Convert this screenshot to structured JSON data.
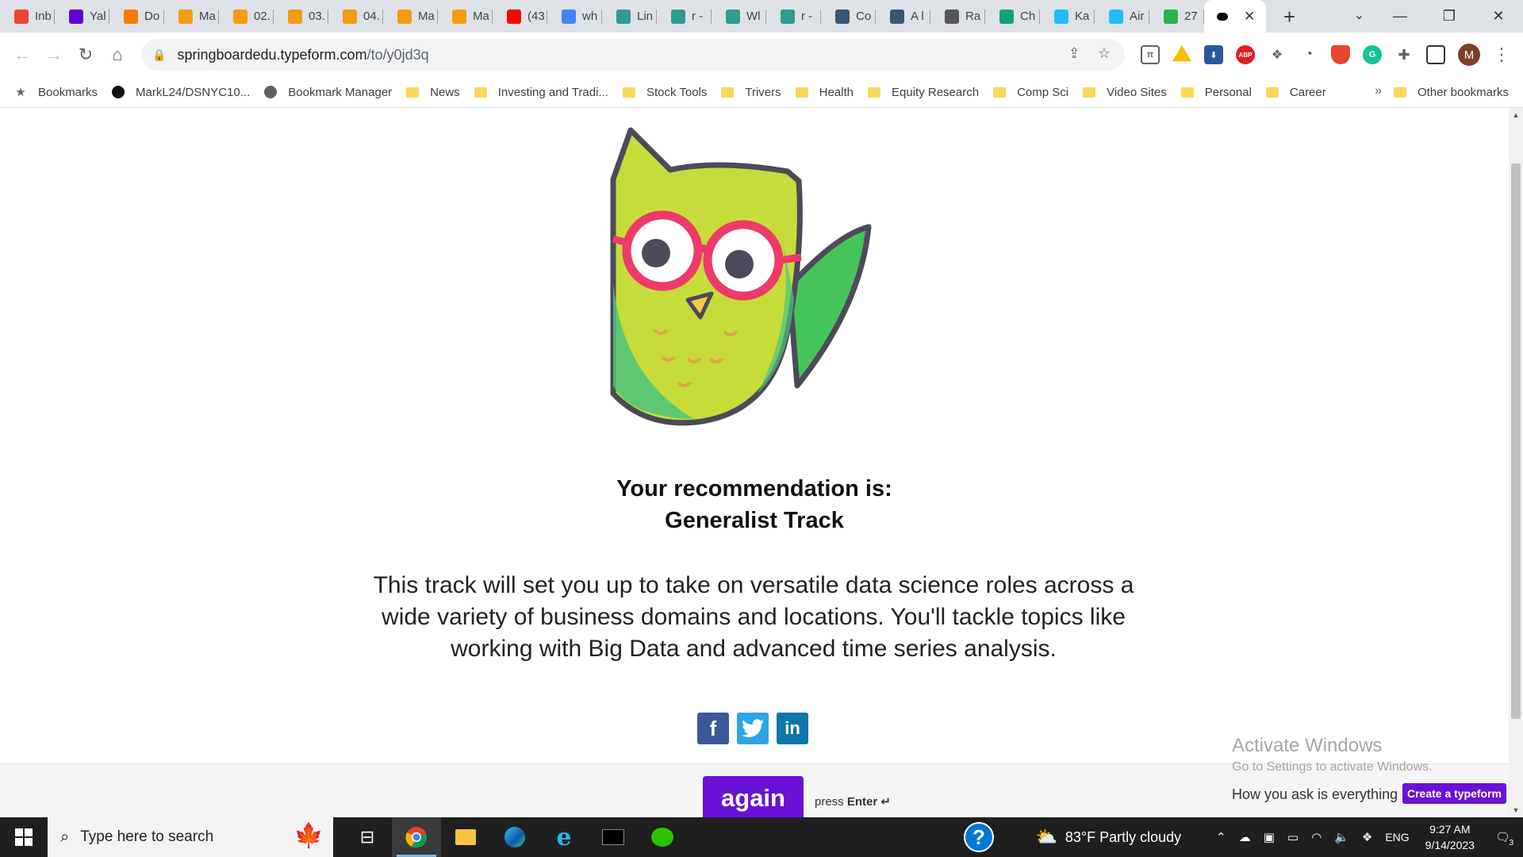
{
  "tabs": [
    {
      "label": "Inb",
      "icon": "gmail-icon",
      "color": "#ea4335"
    },
    {
      "label": "Yal",
      "icon": "yahoo-icon",
      "color": "#6001d2"
    },
    {
      "label": "Do",
      "icon": "loading-icon",
      "color": "#f57c00"
    },
    {
      "label": "Ma",
      "icon": "book-icon",
      "color": "#f39c12"
    },
    {
      "label": "02.",
      "icon": "book-icon",
      "color": "#f39c12"
    },
    {
      "label": "03.",
      "icon": "book-icon",
      "color": "#f39c12"
    },
    {
      "label": "04.",
      "icon": "hourglass-icon",
      "color": "#f39c12"
    },
    {
      "label": "Ma",
      "icon": "book-icon",
      "color": "#f39c12"
    },
    {
      "label": "Ma",
      "icon": "book-icon",
      "color": "#f39c12"
    },
    {
      "label": "(43",
      "icon": "youtube-icon",
      "color": "#ff0000"
    },
    {
      "label": "wh",
      "icon": "google-icon",
      "color": "#4285f4"
    },
    {
      "label": "Lin",
      "icon": "layers-icon",
      "color": "#2e9b8f"
    },
    {
      "label": "r -",
      "icon": "layers-icon",
      "color": "#2e9b8f"
    },
    {
      "label": "Wl",
      "icon": "layers-icon",
      "color": "#2e9b8f"
    },
    {
      "label": "r -",
      "icon": "layers-icon",
      "color": "#2e9b8f"
    },
    {
      "label": "Co",
      "icon": "tds-icon",
      "color": "#355876"
    },
    {
      "label": "A l",
      "icon": "tds-icon",
      "color": "#355876"
    },
    {
      "label": "Ra",
      "icon": "chart-icon",
      "color": "#555555"
    },
    {
      "label": "Ch",
      "icon": "openai-icon",
      "color": "#10a37f"
    },
    {
      "label": "Ka",
      "icon": "k-icon",
      "color": "#20beff"
    },
    {
      "label": "Air",
      "icon": "k-icon",
      "color": "#20beff"
    },
    {
      "label": "27",
      "icon": "dot-icon",
      "color": "#2ab24c"
    }
  ],
  "active_tab": {
    "icon": "typeform-icon"
  },
  "address": {
    "host": "springboardedu.typeform.com",
    "path": "/to/y0jd3q"
  },
  "bookmarks": [
    {
      "label": "Bookmarks",
      "icon": "star-icon"
    },
    {
      "label": "MarkL24/DSNYC10...",
      "icon": "github-icon"
    },
    {
      "label": "Bookmark Manager",
      "icon": "globe-icon"
    },
    {
      "label": "News",
      "icon": "folder-icon"
    },
    {
      "label": "Investing and Tradi...",
      "icon": "folder-icon"
    },
    {
      "label": "Stock Tools",
      "icon": "folder-icon"
    },
    {
      "label": "Trivers",
      "icon": "folder-icon"
    },
    {
      "label": "Health",
      "icon": "folder-icon"
    },
    {
      "label": "Equity Research",
      "icon": "folder-icon"
    },
    {
      "label": "Comp Sci",
      "icon": "folder-icon"
    },
    {
      "label": "Video Sites",
      "icon": "folder-icon"
    },
    {
      "label": "Personal",
      "icon": "folder-icon"
    },
    {
      "label": "Career",
      "icon": "folder-icon"
    }
  ],
  "bookmarks_more": "»",
  "other_bookmarks": "Other bookmarks",
  "profile_initial": "M",
  "page": {
    "heading_line1": "Your recommendation is:",
    "heading_line2": "Generalist Track",
    "description": "This track will set you up to take on versatile data science roles across a wide variety of business domains and locations. You'll tackle topics like working with Big Data and advanced time series analysis.",
    "share": {
      "facebook": "f",
      "twitter": "t",
      "linkedin": "in"
    },
    "again_button": "again",
    "press_prefix": "press",
    "press_key": "Enter ↵",
    "tagline": "How you ask is everything",
    "create_button": "Create a typeform"
  },
  "watermark": {
    "title": "Activate Windows",
    "subtitle": "Go to Settings to activate Windows."
  },
  "taskbar": {
    "search_placeholder": "Type here to search",
    "weather": "83°F  Partly cloudy",
    "lang": "ENG",
    "time": "9:27 AM",
    "date": "9/14/2023",
    "notifications": "3"
  },
  "colors": {
    "accent": "#6a11d6",
    "owl_body": "#c6dc3a",
    "owl_glasses": "#ee3a6a"
  }
}
